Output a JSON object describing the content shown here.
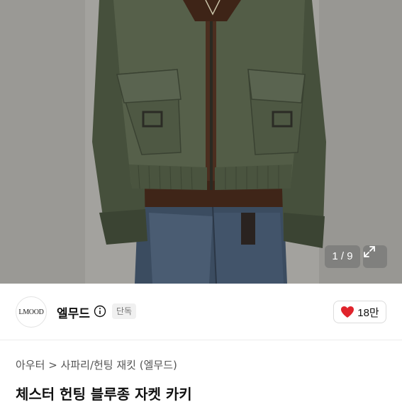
{
  "photo": {
    "alt_icon": "product-photo",
    "counter_current": "1",
    "counter_separator": "/",
    "counter_total": "9",
    "expand_icon": "expand-icon"
  },
  "seller": {
    "logo_text": "LMOOD",
    "name": "엘무드",
    "info_icon": "info-icon",
    "badge": "단독"
  },
  "like": {
    "icon": "heart-icon",
    "count": "18만",
    "color": "#e0242c"
  },
  "breadcrumb": {
    "parent": "아우터",
    "separator": ">",
    "child": "사파리/헌팅 재킷 (엘무드)"
  },
  "product": {
    "title": "체스터 헌팅 블루종 자켓 카키"
  }
}
